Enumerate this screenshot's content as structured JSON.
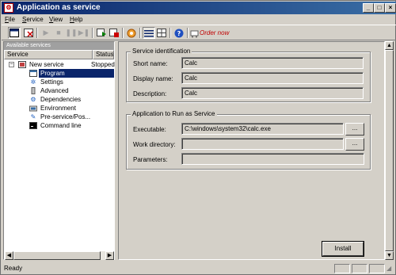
{
  "window": {
    "title": "Application as service"
  },
  "menu": [
    {
      "pre": "",
      "ul": "F",
      "post": "ile"
    },
    {
      "pre": "",
      "ul": "S",
      "post": "ervice"
    },
    {
      "pre": "",
      "ul": "V",
      "post": "iew"
    },
    {
      "pre": "",
      "ul": "H",
      "post": "elp"
    }
  ],
  "toolbar": {
    "order_label": "Order now"
  },
  "services_panel": {
    "caption": "Available services",
    "columns": [
      "Service",
      "Status"
    ],
    "service": {
      "name": "New service",
      "status": "Stopped"
    },
    "nodes": [
      "Program",
      "Settings",
      "Advanced",
      "Dependencies",
      "Environment",
      "Pre-service/Pos...",
      "Command line"
    ],
    "selected": "Program"
  },
  "identification": {
    "title": "Service identification",
    "short_name_label": "Short name:",
    "short_name": "Calc",
    "display_name_label": "Display name:",
    "display_name": "Calc",
    "description_label": "Description:",
    "description": "Calc"
  },
  "app_run": {
    "title": "Application to Run as Service",
    "executable_label": "Executable:",
    "executable": "C:\\windows\\system32\\calc.exe",
    "workdir_label": "Work directory:",
    "workdir": "",
    "params_label": "Parameters:",
    "params": "",
    "browse_label": "..."
  },
  "install_label": "Install",
  "status": {
    "text": "Ready"
  },
  "colors": {
    "title_start": "#0a246a",
    "title_end": "#3a6ea5",
    "selection": "#0a246a",
    "order": "#c00000"
  }
}
